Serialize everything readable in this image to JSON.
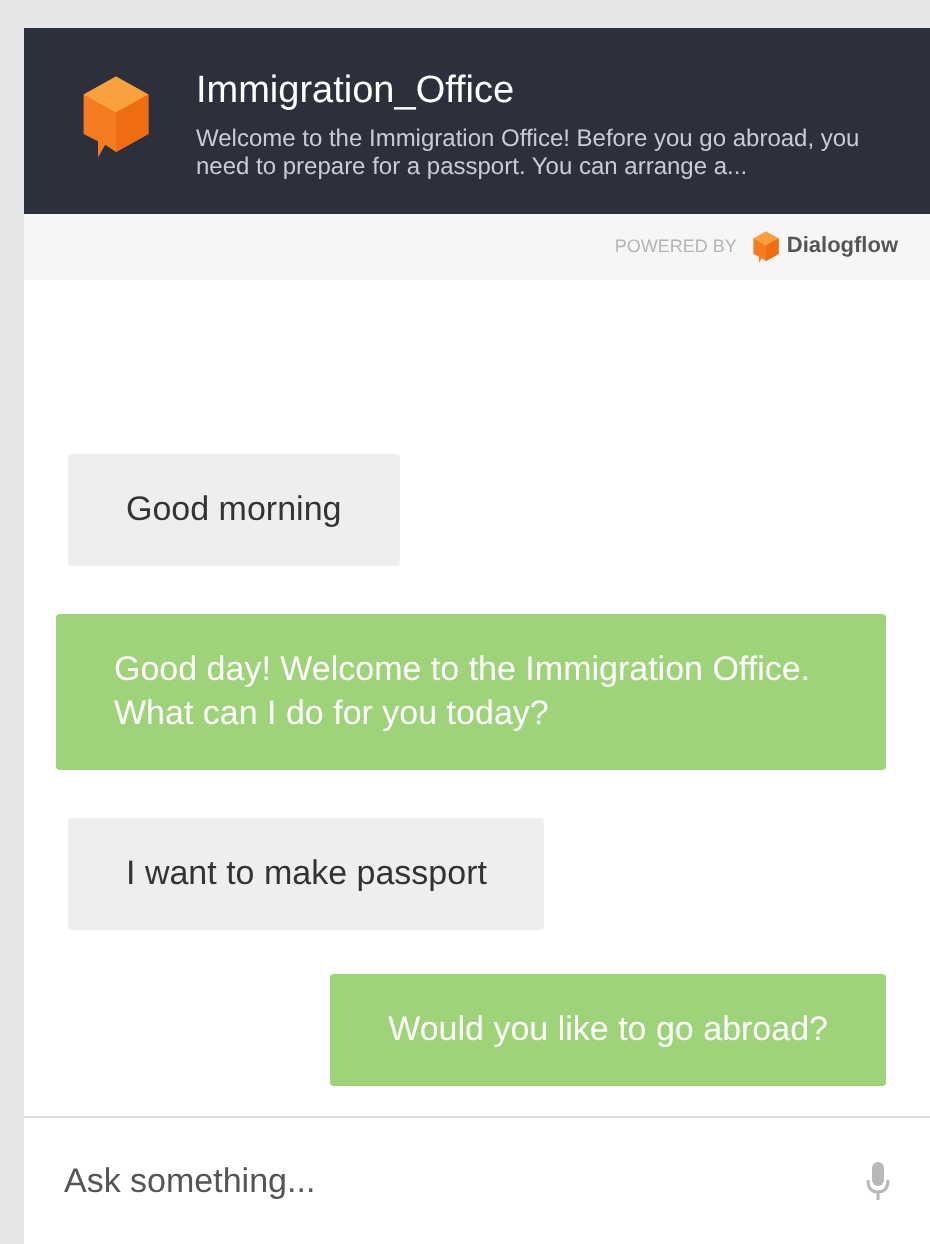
{
  "header": {
    "title": "Immigration_Office",
    "description": "Welcome to the Immigration Office! Before you go abroad, you need to prepare for a passport. You can arrange a..."
  },
  "powered_by": {
    "label": "POWERED BY",
    "brand": "Dialogflow"
  },
  "messages": [
    {
      "kind": "user",
      "text": "Good morning"
    },
    {
      "kind": "agent",
      "text": "Good day! Welcome to the Immigration Office. What can I do for you today?"
    },
    {
      "kind": "user",
      "text": "I want to make passport"
    },
    {
      "kind": "agent",
      "text": "Would you like to go abroad?"
    }
  ],
  "input": {
    "placeholder": "Ask something..."
  }
}
